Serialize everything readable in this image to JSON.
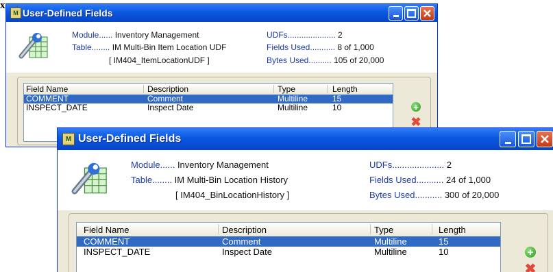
{
  "corner_label": "x",
  "back_window": {
    "title": "User-Defined Fields",
    "module_label": "Module......",
    "module_value": "Inventory Management",
    "table_label": "Table........",
    "table_value": "IM Multi-Bin Item Location UDF",
    "table_code": "[ IM404_ItemLocationUDF ]",
    "udfs_label": "UDFs.....................",
    "udfs_value": "2",
    "fields_label": "Fields Used...........",
    "fields_value": "8 of 1,000",
    "bytes_label": "Bytes Used..........",
    "bytes_value": "105 of 20,000",
    "columns": [
      "Field Name",
      "Description",
      "Type",
      "Length"
    ],
    "rows": [
      {
        "name": "COMMENT",
        "description": "Comment",
        "type": "Multiline",
        "length": "15",
        "selected": true
      },
      {
        "name": "INSPECT_DATE",
        "description": "Inspect Date",
        "type": "Multiline",
        "length": "10",
        "selected": false
      }
    ]
  },
  "front_window": {
    "title": "User-Defined Fields",
    "module_label": "Module......",
    "module_value": "Inventory Management",
    "table_label": "Table........",
    "table_value": "IM Multi-Bin Location History",
    "table_code": "[ IM404_BinLocationHistory ]",
    "udfs_label": "UDFs.....................",
    "udfs_value": "2",
    "fields_label": "Fields Used...........",
    "fields_value": "24 of 1,000",
    "bytes_label": "Bytes Used...........",
    "bytes_value": "300 of 20,000",
    "columns": [
      "Field Name",
      "Description",
      "Type",
      "Length"
    ],
    "rows": [
      {
        "name": "COMMENT",
        "description": "Comment",
        "type": "Multiline",
        "length": "15",
        "selected": true
      },
      {
        "name": "INSPECT_DATE",
        "description": "Inspect Date",
        "type": "Multiline",
        "length": "10",
        "selected": false
      }
    ]
  },
  "icons": {
    "app": "udf-app-icon",
    "tool": "wrench-spreadsheet-icon",
    "add": "add-plus-icon",
    "delete": "delete-x-icon",
    "minimize": "minimize-icon",
    "maximize": "maximize-icon",
    "close": "close-icon"
  },
  "colors": {
    "titlebar": "#0a58e0",
    "window_bg": "#ece9d8",
    "label_blue": "#1d3aa8",
    "selection": "#316ac5",
    "close_red": "#c23a1a"
  }
}
